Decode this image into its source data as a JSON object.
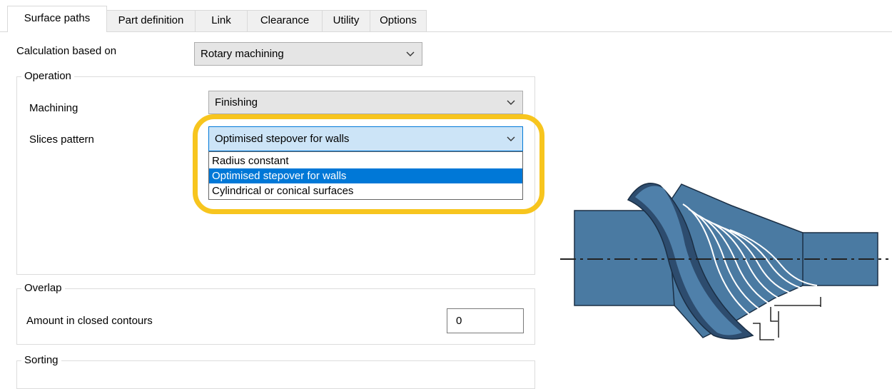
{
  "tabs": [
    {
      "label": "Surface paths",
      "active": true
    },
    {
      "label": "Part definition",
      "active": false
    },
    {
      "label": "Link",
      "active": false
    },
    {
      "label": "Clearance",
      "active": false
    },
    {
      "label": "Utility",
      "active": false
    },
    {
      "label": "Options",
      "active": false
    }
  ],
  "calculation": {
    "label": "Calculation based on",
    "value": "Rotary machining"
  },
  "operation": {
    "title": "Operation",
    "machining_label": "Machining",
    "machining_value": "Finishing",
    "slices_label": "Slices pattern",
    "slices_value": "Optimised stepover for walls",
    "slices_options": [
      "Radius constant",
      "Optimised stepover for walls",
      "Cylindrical or conical surfaces"
    ]
  },
  "overlap": {
    "title": "Overlap",
    "amount_label": "Amount in closed contours",
    "amount_value": "0"
  },
  "sorting": {
    "title": "Sorting"
  },
  "colors": {
    "highlight": "#f7c51e",
    "selection": "#0078d7",
    "part_blue": "#4a7aa2",
    "part_dark": "#2d4c6e"
  }
}
